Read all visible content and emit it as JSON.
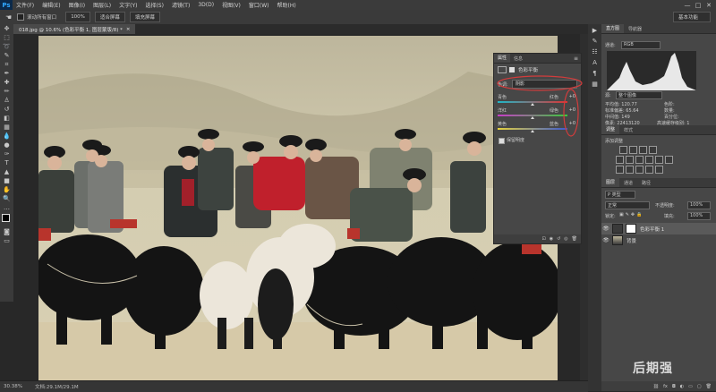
{
  "app": {
    "logo": "Ps"
  },
  "menu": [
    "文件(F)",
    "编辑(E)",
    "图像(I)",
    "图层(L)",
    "文字(Y)",
    "选择(S)",
    "滤镜(T)",
    "3D(D)",
    "视图(V)",
    "窗口(W)",
    "帮助(H)"
  ],
  "window_controls": {
    "minimize": "—",
    "maximize": "□",
    "close": "✕"
  },
  "options_bar": {
    "tool_glyph": "☚",
    "scroll_all_label": "滚动所有窗口",
    "zoom_value": "100%",
    "fit_screen": "适合屏幕",
    "fill_screen": "填充屏幕",
    "workspace_value": "基本功能"
  },
  "doc_tab": {
    "title": "018.jpg @ 10.6% (色彩平衡 1, 图层蒙版/8) *",
    "close": "×"
  },
  "status": {
    "zoom": "30.38%",
    "doc_size": "文档:29.1M/29.1M"
  },
  "properties": {
    "tabs": [
      "属性",
      "信息"
    ],
    "title": "色彩平衡",
    "tone_label": "色调:",
    "tone_value": "阴影",
    "sliders": [
      {
        "left": "青色",
        "right": "红色",
        "value": "+0",
        "pos": 0.5
      },
      {
        "left": "洋红",
        "right": "绿色",
        "value": "+0",
        "pos": 0.5
      },
      {
        "left": "黄色",
        "right": "蓝色",
        "value": "+0",
        "pos": 0.5
      }
    ],
    "preserve_label": "保留明度"
  },
  "histogram": {
    "tabs": [
      "直方图",
      "导航器"
    ],
    "channel_label": "通道:",
    "channel_value": "RGB",
    "source_label": "源:",
    "source_value": "整个图像",
    "stats_left": [
      "平均值: 120.77",
      "标准偏差: 65.64",
      "中间值: 149",
      "像素: 22413120"
    ],
    "stats_right": [
      "色阶:",
      "数量:",
      "百分位:",
      "高速缓存级别: 1"
    ]
  },
  "adjustments": {
    "tabs": [
      "调整",
      "样式"
    ],
    "add_label": "添加调整"
  },
  "layers": {
    "tabs": [
      "图层",
      "通道",
      "路径"
    ],
    "filter_label": "P 类型",
    "blend_mode": "正常",
    "opacity_label": "不透明度:",
    "opacity_value": "100%",
    "lock_label": "锁定:",
    "fill_label": "填充:",
    "fill_value": "100%",
    "items": [
      {
        "name": "色彩平衡 1",
        "selected": true
      },
      {
        "name": "背景",
        "selected": false
      }
    ]
  },
  "watermark": "后期强",
  "colors": {
    "accent_annotation": "#d23c3c",
    "panel_bg": "#474747",
    "selected_layer": "#5a5a5a"
  }
}
